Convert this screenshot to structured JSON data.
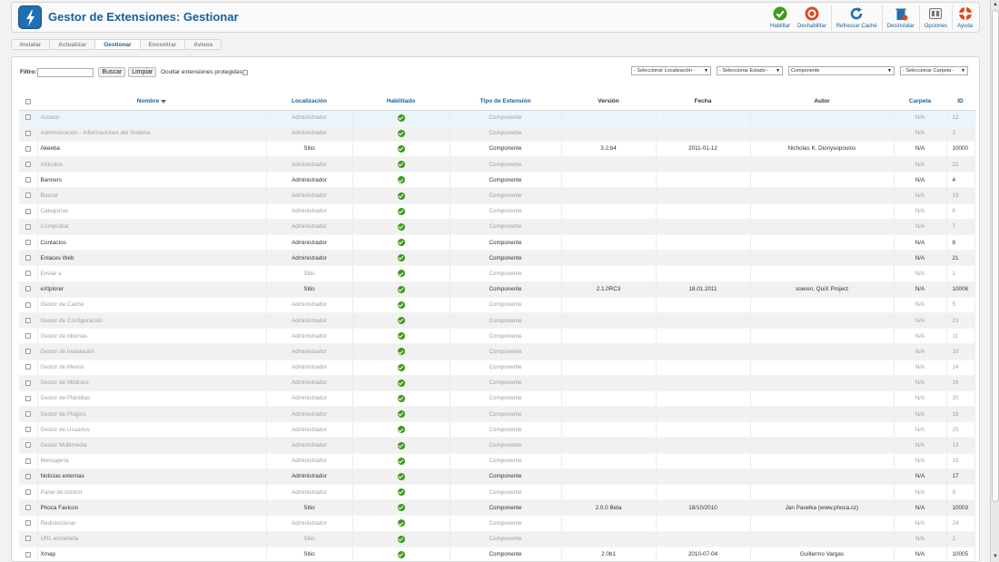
{
  "header": {
    "title": "Gestor de Extensiones: Gestionar",
    "toolbar": [
      {
        "id": "enable",
        "label": "Habilitar",
        "icon": "check-circle-icon",
        "color": "#3f9a1e"
      },
      {
        "id": "disable",
        "label": "Deshabilitar",
        "icon": "disable-circle-icon",
        "color": "#e0461b"
      },
      {
        "id": "refresh",
        "label": "Refrescar Caché",
        "icon": "refresh-icon",
        "color": "#1f6fb2"
      },
      {
        "id": "uninstall",
        "label": "Desinstalar",
        "icon": "trash-icon",
        "color": "#1f6fb2"
      },
      {
        "id": "options",
        "label": "Opciones",
        "icon": "options-icon",
        "color": "#555555"
      },
      {
        "id": "help",
        "label": "Ayuda",
        "icon": "lifebuoy-icon",
        "color": "#e0461b"
      }
    ]
  },
  "tabs": [
    {
      "label": "Instalar",
      "active": false
    },
    {
      "label": "Actualizar",
      "active": false
    },
    {
      "label": "Gestionar",
      "active": true
    },
    {
      "label": "Encontrar",
      "active": false
    },
    {
      "label": "Avisos",
      "active": false
    }
  ],
  "filter": {
    "label": "Filtro:",
    "value": "",
    "search_button": "Buscar",
    "clear_button": "Limpiar",
    "hide_protected_label": "Ocultar extensiones protegidas"
  },
  "selects": {
    "location": "- Seleccionar Localización -",
    "state": "- Seleccionar Estado -",
    "type": "Componente",
    "folder": "- Seleccionar Carpeta -"
  },
  "table": {
    "columns": {
      "name": "Nombre",
      "location": "Localización",
      "enabled": "Habilitado",
      "type": "Tipo de Extensión",
      "version": "Versión",
      "date": "Fecha",
      "author": "Autor",
      "folder": "Carpeta",
      "id": "ID"
    },
    "rows": [
      {
        "name": "Acceso",
        "location": "Administrador",
        "type": "Componente",
        "version": "",
        "date": "",
        "author": "",
        "folder": "N/A",
        "id": "12",
        "dim": true
      },
      {
        "name": "Administración - Informaciones del Sistema",
        "location": "Administrador",
        "type": "Componente",
        "version": "",
        "date": "",
        "author": "",
        "folder": "N/A",
        "id": "3",
        "dim": true
      },
      {
        "name": "Akeeba",
        "location": "Sitio",
        "type": "Componente",
        "version": "3.2.b4",
        "date": "2011-01-12",
        "author": "Nicholas K. Dionysopoulos",
        "folder": "N/A",
        "id": "10000",
        "dim": false
      },
      {
        "name": "Artículos",
        "location": "Administrador",
        "type": "Componente",
        "version": "",
        "date": "",
        "author": "",
        "folder": "N/A",
        "id": "22",
        "dim": true
      },
      {
        "name": "Banners",
        "location": "Administrador",
        "type": "Componente",
        "version": "",
        "date": "",
        "author": "",
        "folder": "N/A",
        "id": "4",
        "dim": false
      },
      {
        "name": "Buscar",
        "location": "Administrador",
        "type": "Componente",
        "version": "",
        "date": "",
        "author": "",
        "folder": "N/A",
        "id": "19",
        "dim": true
      },
      {
        "name": "Categorías",
        "location": "Administrador",
        "type": "Componente",
        "version": "",
        "date": "",
        "author": "",
        "folder": "N/A",
        "id": "6",
        "dim": true
      },
      {
        "name": "Comprobar",
        "location": "Administrador",
        "type": "Componente",
        "version": "",
        "date": "",
        "author": "",
        "folder": "N/A",
        "id": "7",
        "dim": true
      },
      {
        "name": "Contactos",
        "location": "Administrador",
        "type": "Componente",
        "version": "",
        "date": "",
        "author": "",
        "folder": "N/A",
        "id": "8",
        "dim": false
      },
      {
        "name": "Enlaces Web",
        "location": "Administrador",
        "type": "Componente",
        "version": "",
        "date": "",
        "author": "",
        "folder": "N/A",
        "id": "21",
        "dim": false
      },
      {
        "name": "Enviar a",
        "location": "Sitio",
        "type": "Componente",
        "version": "",
        "date": "",
        "author": "",
        "folder": "N/A",
        "id": "1",
        "dim": true
      },
      {
        "name": "eXtplorer",
        "location": "Sitio",
        "type": "Componente",
        "version": "2.1.0RC3",
        "date": "18.01.2011",
        "author": "soeren, QuiX Project",
        "folder": "N/A",
        "id": "10008",
        "dim": false
      },
      {
        "name": "Gestor de Caché",
        "location": "Administrador",
        "type": "Componente",
        "version": "",
        "date": "",
        "author": "",
        "folder": "N/A",
        "id": "5",
        "dim": true
      },
      {
        "name": "Gestor de Configuración",
        "location": "Administrador",
        "type": "Componente",
        "version": "",
        "date": "",
        "author": "",
        "folder": "N/A",
        "id": "23",
        "dim": true
      },
      {
        "name": "Gestor de Idiomas",
        "location": "Administrador",
        "type": "Componente",
        "version": "",
        "date": "",
        "author": "",
        "folder": "N/A",
        "id": "11",
        "dim": true
      },
      {
        "name": "Gestor de Instalación",
        "location": "Administrador",
        "type": "Componente",
        "version": "",
        "date": "",
        "author": "",
        "folder": "N/A",
        "id": "10",
        "dim": true
      },
      {
        "name": "Gestor de Menús",
        "location": "Administrador",
        "type": "Componente",
        "version": "",
        "date": "",
        "author": "",
        "folder": "N/A",
        "id": "14",
        "dim": true
      },
      {
        "name": "Gestor de Módulos",
        "location": "Administrador",
        "type": "Componente",
        "version": "",
        "date": "",
        "author": "",
        "folder": "N/A",
        "id": "16",
        "dim": true
      },
      {
        "name": "Gestor de Plantillas",
        "location": "Administrador",
        "type": "Componente",
        "version": "",
        "date": "",
        "author": "",
        "folder": "N/A",
        "id": "20",
        "dim": true
      },
      {
        "name": "Gestor de Plugins",
        "location": "Administrador",
        "type": "Componente",
        "version": "",
        "date": "",
        "author": "",
        "folder": "N/A",
        "id": "18",
        "dim": true
      },
      {
        "name": "Gestor de Usuarios",
        "location": "Administrador",
        "type": "Componente",
        "version": "",
        "date": "",
        "author": "",
        "folder": "N/A",
        "id": "25",
        "dim": true
      },
      {
        "name": "Gestor Multimedia",
        "location": "Administrador",
        "type": "Componente",
        "version": "",
        "date": "",
        "author": "",
        "folder": "N/A",
        "id": "13",
        "dim": true
      },
      {
        "name": "Mensajería",
        "location": "Administrador",
        "type": "Componente",
        "version": "",
        "date": "",
        "author": "",
        "folder": "N/A",
        "id": "15",
        "dim": true
      },
      {
        "name": "Noticias externas",
        "location": "Administrador",
        "type": "Componente",
        "version": "",
        "date": "",
        "author": "",
        "folder": "N/A",
        "id": "17",
        "dim": false
      },
      {
        "name": "Panel de control",
        "location": "Administrador",
        "type": "Componente",
        "version": "",
        "date": "",
        "author": "",
        "folder": "N/A",
        "id": "9",
        "dim": true
      },
      {
        "name": "Phoca Favicon",
        "location": "Sitio",
        "type": "Componente",
        "version": "2.0.0 Beta",
        "date": "18/10/2010",
        "author": "Jan Pavelka (www.phoca.cz)",
        "folder": "N/A",
        "id": "10003",
        "dim": false
      },
      {
        "name": "Redireccionar",
        "location": "Administrador",
        "type": "Componente",
        "version": "",
        "date": "",
        "author": "",
        "folder": "N/A",
        "id": "24",
        "dim": true
      },
      {
        "name": "URL embebida",
        "location": "Sitio",
        "type": "Componente",
        "version": "",
        "date": "",
        "author": "",
        "folder": "N/A",
        "id": "2",
        "dim": true
      },
      {
        "name": "Xmap",
        "location": "Sitio",
        "type": "Componente",
        "version": "2.0b1",
        "date": "2010-07-04",
        "author": "Guillermo Vargas",
        "folder": "N/A",
        "id": "10005",
        "dim": false
      }
    ]
  }
}
